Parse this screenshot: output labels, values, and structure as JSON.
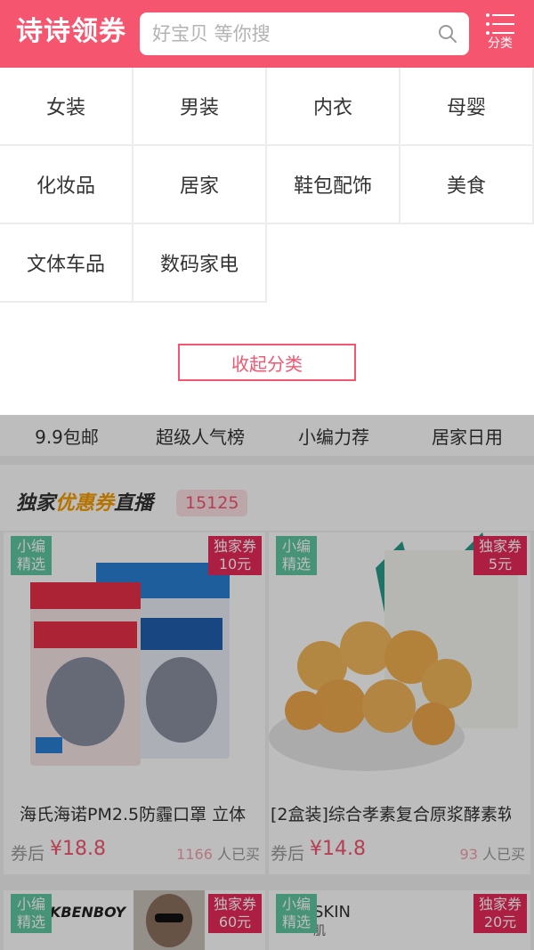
{
  "header": {
    "logo": "诗诗领券",
    "search_placeholder": "好宝贝 等你搜",
    "category_label": "分类"
  },
  "categories": [
    "女装",
    "男装",
    "内衣",
    "母婴",
    "化妆品",
    "居家",
    "鞋包配饰",
    "美食",
    "文体车品",
    "数码家电"
  ],
  "collapse_label": "收起分类",
  "tabs": [
    "9.9包邮",
    "超级人气榜",
    "小编力荐",
    "居家日用"
  ],
  "section": {
    "title_prefix": "独家",
    "title_highlight": "优惠券",
    "title_suffix": "直播",
    "count": "15125"
  },
  "products": [
    {
      "pick_tag": "小编\n精选",
      "coupon_tag": "独家券\n10元",
      "title": "海氏海诺PM2.5防霾口罩 立体",
      "price_label": "券后",
      "price": "¥18.8",
      "sold_count": "1166",
      "sold_suffix": "人已买"
    },
    {
      "pick_tag": "小编\n精选",
      "coupon_tag": "独家券\n5元",
      "title": "[2盒装]综合孝素复合原浆酵素软",
      "price_label": "券后",
      "price": "¥14.8",
      "sold_count": "93",
      "sold_suffix": "人已买"
    },
    {
      "pick_tag": "小编\n精选",
      "coupon_tag": "独家券\n60元"
    },
    {
      "pick_tag": "小编\n精选",
      "coupon_tag": "独家券\n20元"
    }
  ],
  "colors": {
    "brand": "#f5556f",
    "pick_tag": "#5fc7a3",
    "coupon_tag": "#e8295a"
  }
}
